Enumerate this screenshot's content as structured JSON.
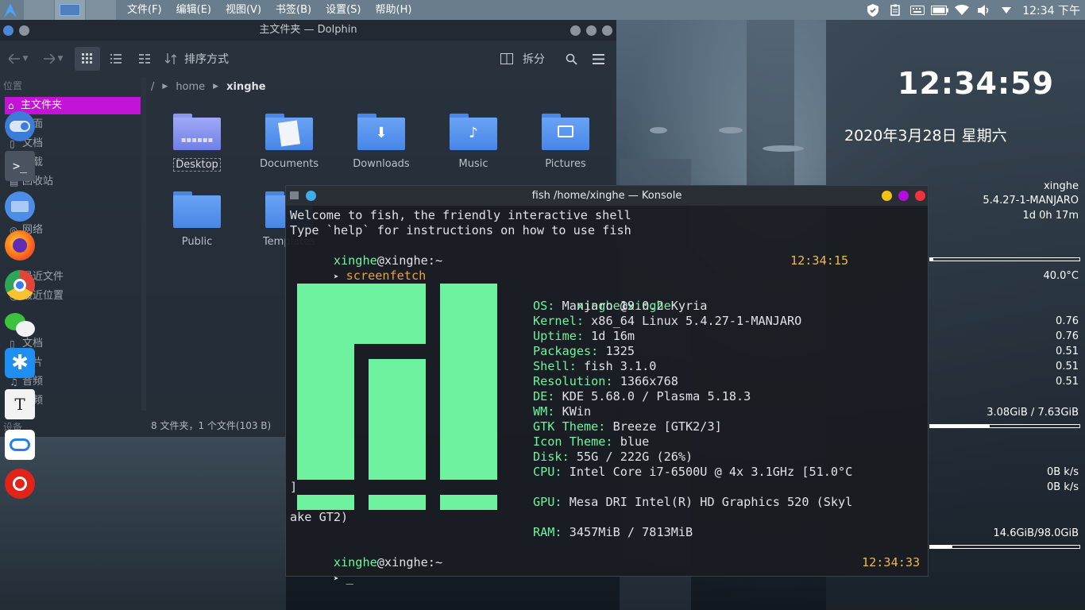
{
  "top_panel": {
    "menu": [
      "文件(F)",
      "编辑(E)",
      "视图(V)",
      "书签(B)",
      "设置(S)",
      "帮助(H)"
    ],
    "clock": "12:34 下午",
    "tray_icons": [
      "shield-icon",
      "clipboard-icon",
      "keyboard-icon",
      "battery-icon",
      "wifi-icon",
      "volume-icon",
      "expand-icon"
    ]
  },
  "dolphin": {
    "title": "主文件夹 — Dolphin",
    "sort_label": "排序方式",
    "split_label": "拆分",
    "places_header": "位置",
    "places": [
      {
        "label": "主文件夹",
        "icon": "home-icon"
      },
      {
        "label": "桌面",
        "icon": "desktop-icon"
      },
      {
        "label": "文档",
        "icon": "document-icon"
      },
      {
        "label": "下载",
        "icon": "download-icon"
      },
      {
        "label": "回收站",
        "icon": "trash-icon"
      },
      {
        "label": "网络",
        "icon": "network-icon"
      },
      {
        "label": "最近文件",
        "icon": "recent-files-icon"
      },
      {
        "label": "最近位置",
        "icon": "recent-locations-icon"
      },
      {
        "label": "文档",
        "icon": "document-icon"
      },
      {
        "label": "图片",
        "icon": "image-icon"
      },
      {
        "label": "音频",
        "icon": "audio-icon"
      },
      {
        "label": "视频",
        "icon": "video-icon"
      }
    ],
    "places_footer": "设备",
    "breadcrumb": [
      "/",
      "home",
      "xinghe"
    ],
    "files": [
      "Desktop",
      "Documents",
      "Downloads",
      "Music",
      "Pictures",
      "Public",
      "Templates"
    ],
    "status": "8 文件夹，1 个文件(103 B)"
  },
  "konsole": {
    "title": "fish /home/xinghe — Konsole",
    "welcome1": "Welcome to fish, the friendly interactive shell",
    "welcome2": "Type `help` for instructions on how to use fish",
    "user": "xinghe",
    "host": "xinghe",
    "cwd": "~",
    "command": "screenfetch",
    "time1": "12:34:15",
    "time2": "12:34:33",
    "info": [
      {
        "key": "OS:",
        "value": " Manjaro 19.0.2 Kyria"
      },
      {
        "key": "Kernel:",
        "value": " x86_64 Linux 5.4.27-1-MANJARO"
      },
      {
        "key": "Uptime:",
        "value": " 1d 16m"
      },
      {
        "key": "Packages:",
        "value": " 1325"
      },
      {
        "key": "Shell:",
        "value": " fish 3.1.0"
      },
      {
        "key": "Resolution:",
        "value": " 1366x768"
      },
      {
        "key": "DE:",
        "value": " KDE 5.68.0 / Plasma 5.18.3"
      },
      {
        "key": "WM:",
        "value": " KWin"
      },
      {
        "key": "GTK Theme:",
        "value": " Breeze [GTK2/3]"
      },
      {
        "key": "Icon Theme:",
        "value": " blue"
      },
      {
        "key": "Disk:",
        "value": " 55G / 222G (26%)"
      },
      {
        "key": "CPU:",
        "value": " Intel Core i7-6500U @ 4x 3.1GHz [51.0°C"
      }
    ],
    "bracket": "]",
    "gpu_key": "GPU:",
    "gpu_value": " Mesa DRI Intel(R) HD Graphics 520 (Skyl",
    "gpu_wrap": "ake GT2)",
    "ram_key": "RAM:",
    "ram_value": " 3457MiB / 7813MiB",
    "prompt_glyph": "➤",
    "cursor": "_",
    "accent_green": "#6df59e",
    "accent_orange": "#e8a33b"
  },
  "conky": {
    "time": "12:34:59",
    "date": "2020年3月28日 星期六",
    "user": "xinghe",
    "kernel": "5.4.27-1-MANJARO",
    "uptime": "1d 0h 17m",
    "temp": "40.0°C",
    "loads": [
      "0.76",
      "0.76",
      "0.51",
      "0.51",
      "0.51"
    ],
    "memory": "3.08GiB / 7.63GiB",
    "memory_fraction": 0.4,
    "net_down": "0B k/s",
    "net_up": "0B k/s",
    "disk": "14.6GiB/98.0GiB",
    "disk_fraction": 0.15
  }
}
